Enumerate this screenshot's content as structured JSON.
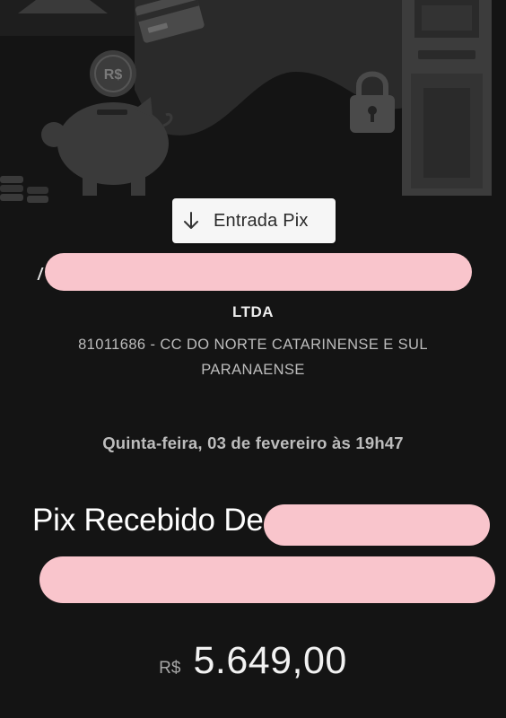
{
  "header": {
    "illustration_icons": [
      "credit-card-icon",
      "coin-icon",
      "piggy-bank-icon",
      "padlock-icon",
      "atm-icon",
      "coin-stack-icon"
    ],
    "coin_symbol": "R$"
  },
  "transaction": {
    "type_label": "Entrada Pix",
    "type_icon": "arrow-down-icon",
    "company_suffix": "LTDA",
    "bank_line_1": "81011686 - CC DO NORTE CATARINENSE E SUL",
    "bank_line_2": "PARANAENSE",
    "date": "Quinta-feira, 03 de fevereiro às 19h47",
    "message": "Pix Recebido De",
    "currency": "R$",
    "amount": "5.649,00"
  },
  "colors": {
    "background": "#141414",
    "pill_background": "#f6f6f6",
    "redaction": "#f9c5cc"
  }
}
